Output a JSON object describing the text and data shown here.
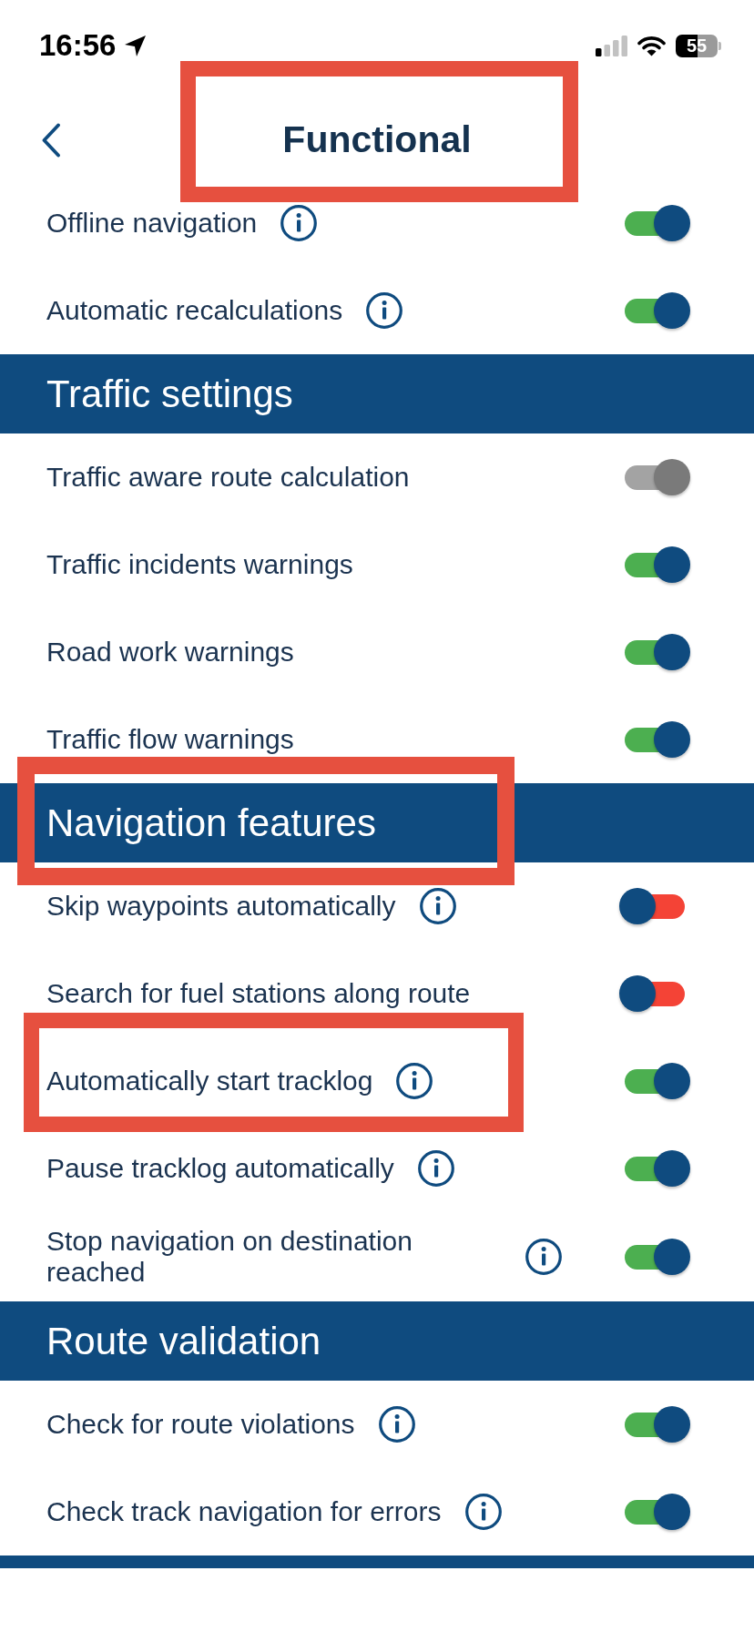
{
  "status_bar": {
    "time": "16:56",
    "battery": "55"
  },
  "header": {
    "title": "Functional"
  },
  "sections": [
    {
      "rows": [
        {
          "label": "Offline navigation",
          "info": true,
          "on": true,
          "disabled": false
        },
        {
          "label": "Automatic recalculations",
          "info": true,
          "on": true,
          "disabled": false
        }
      ]
    },
    {
      "title": "Traffic settings",
      "rows": [
        {
          "label": "Traffic aware route calculation",
          "info": false,
          "on": true,
          "disabled": true
        },
        {
          "label": "Traffic incidents warnings",
          "info": false,
          "on": true,
          "disabled": false
        },
        {
          "label": "Road work warnings",
          "info": false,
          "on": true,
          "disabled": false
        },
        {
          "label": "Traffic flow warnings",
          "info": false,
          "on": true,
          "disabled": false
        }
      ]
    },
    {
      "title": "Navigation features",
      "rows": [
        {
          "label": "Skip waypoints automatically",
          "info": true,
          "on": false,
          "disabled": false
        },
        {
          "label": "Search for fuel stations along route",
          "info": false,
          "on": false,
          "disabled": false
        },
        {
          "label": "Automatically start tracklog",
          "info": true,
          "on": true,
          "disabled": false
        },
        {
          "label": "Pause tracklog automatically",
          "info": true,
          "on": true,
          "disabled": false
        },
        {
          "label": "Stop navigation on destination reached",
          "info": true,
          "on": true,
          "disabled": false
        }
      ]
    },
    {
      "title": "Route validation",
      "rows": [
        {
          "label": "Check for route violations",
          "info": true,
          "on": true,
          "disabled": false
        },
        {
          "label": "Check track navigation for errors",
          "info": true,
          "on": true,
          "disabled": false
        }
      ]
    }
  ]
}
